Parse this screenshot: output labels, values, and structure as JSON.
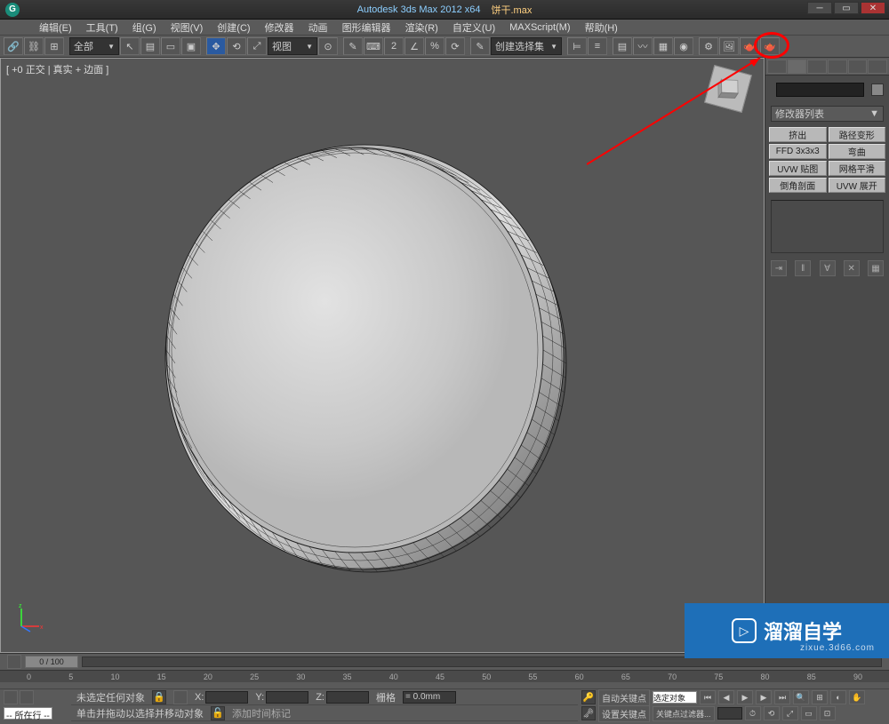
{
  "title": {
    "app": "Autodesk 3ds Max  2012 x64",
    "file": "饼干.max"
  },
  "menu": [
    "编辑(E)",
    "工具(T)",
    "组(G)",
    "视图(V)",
    "创建(C)",
    "修改器",
    "动画",
    "图形编辑器",
    "渲染(R)",
    "自定义(U)",
    "MAXScript(M)",
    "帮助(H)"
  ],
  "dropdowns": {
    "all": "全部",
    "view": "视图",
    "selset": "创建选择集"
  },
  "viewport": {
    "label": "[ +0 正交 | 真实 + 边面 ]"
  },
  "panel": {
    "modlist": "修改器列表",
    "mods": [
      "挤出",
      "路径变形",
      "FFD 3x3x3",
      "弯曲",
      "UVW 贴图",
      "网格平滑",
      "倒角剖面",
      "UVW 展开"
    ]
  },
  "timeline": {
    "slider_label": "0 / 100",
    "ticks": [
      "0",
      "5",
      "10",
      "15",
      "20",
      "25",
      "30",
      "35",
      "40",
      "45",
      "50",
      "55",
      "60",
      "65",
      "70",
      "75",
      "80",
      "85",
      "90"
    ]
  },
  "status": {
    "row_select": "-- 所在行 --",
    "no_selection": "未选定任何对象",
    "hint": "单击并拖动以选择并移动对象",
    "add_timetag": "添加时间标记",
    "coords": {
      "x": "X:",
      "y": "Y:",
      "z": "Z:"
    },
    "grid_label": "栅格",
    "grid_value": "= 0.0mm",
    "autokey": "自动关键点",
    "selset": "选定对象",
    "setkey": "设置关键点",
    "keyfilter": "关键点过滤器..."
  },
  "watermark": {
    "text": "溜溜自学",
    "sub": "zixue.3d66.com",
    "play": "▷"
  }
}
